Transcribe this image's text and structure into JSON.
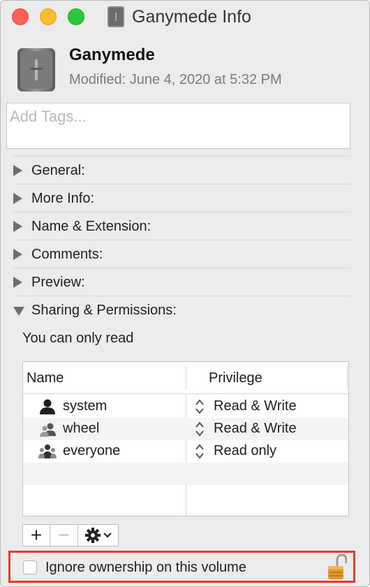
{
  "window": {
    "title": "Ganymede Info"
  },
  "header": {
    "name": "Ganymede",
    "modified": "Modified: June 4, 2020 at 5:32 PM"
  },
  "tags": {
    "placeholder": "Add Tags..."
  },
  "sections": [
    {
      "label": "General:",
      "expanded": false
    },
    {
      "label": "More Info:",
      "expanded": false
    },
    {
      "label": "Name & Extension:",
      "expanded": false
    },
    {
      "label": "Comments:",
      "expanded": false
    },
    {
      "label": "Preview:",
      "expanded": false
    },
    {
      "label": "Sharing & Permissions:",
      "expanded": true
    }
  ],
  "permissions": {
    "note": "You can only read",
    "columns": {
      "name": "Name",
      "privilege": "Privilege"
    },
    "rows": [
      {
        "name": "system",
        "privilege": "Read & Write",
        "icon": "single-user-icon"
      },
      {
        "name": "wheel",
        "privilege": "Read & Write",
        "icon": "group-icon"
      },
      {
        "name": "everyone",
        "privilege": "Read only",
        "icon": "everyone-icon"
      }
    ],
    "buttons": {
      "add": "+",
      "remove": "−"
    }
  },
  "ignore_ownership": {
    "label": "Ignore ownership on this volume",
    "checked": false
  },
  "colors": {
    "highlight": "#e8392b",
    "lock": "#e6962d"
  }
}
